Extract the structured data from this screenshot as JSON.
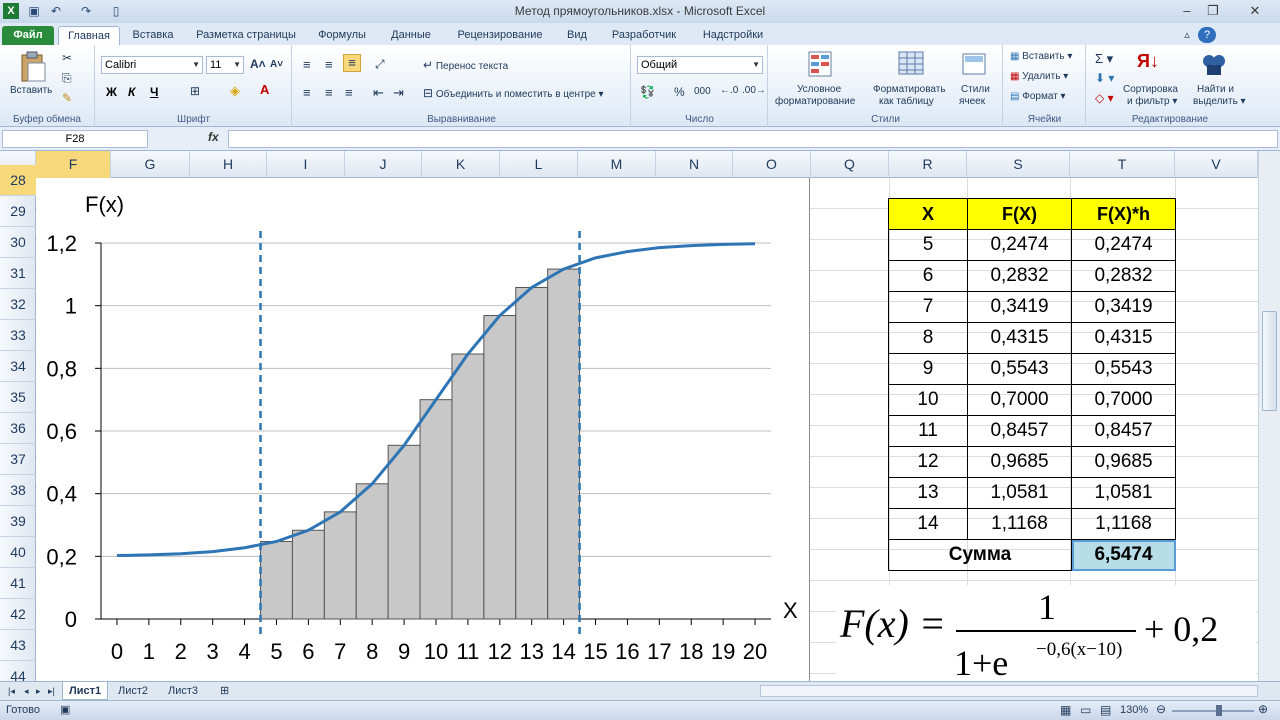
{
  "window": {
    "title": "Метод прямоугольников.xlsx  -  Microsoft Excel",
    "app_icon": "excel-logo-icon",
    "qat_icons": [
      "save-icon",
      "undo-icon",
      "redo-icon",
      "new-document-icon"
    ]
  },
  "tabs": [
    {
      "label": "Файл"
    },
    {
      "label": "Главная"
    },
    {
      "label": "Вставка"
    },
    {
      "label": "Разметка страницы"
    },
    {
      "label": "Формулы"
    },
    {
      "label": "Данные"
    },
    {
      "label": "Рецензирование"
    },
    {
      "label": "Вид"
    },
    {
      "label": "Разработчик"
    },
    {
      "label": "Надстройки"
    }
  ],
  "ribbon": {
    "clipboard": {
      "paste": "Вставить",
      "group": "Буфер обмена"
    },
    "font": {
      "name": "Calibri",
      "size": "11",
      "bold": "Ж",
      "italic": "К",
      "underline": "Ч",
      "group": "Шрифт"
    },
    "alignment": {
      "wrap": "Перенос текста",
      "merge": "Объединить и поместить в центре",
      "group": "Выравнивание"
    },
    "number": {
      "format": "Общий",
      "percent": "%",
      "thousands": "000",
      "group": "Число"
    },
    "styles": {
      "cond_line1": "Условное",
      "cond_line2": "форматирование",
      "table_line1": "Форматировать",
      "table_line2": "как таблицу",
      "cell_line1": "Стили",
      "cell_line2": "ячеек",
      "group": "Стили"
    },
    "cells": {
      "insert": "Вставить",
      "delete": "Удалить",
      "format": "Формат",
      "group": "Ячейки"
    },
    "editing": {
      "sort_line1": "Сортировка",
      "sort_line2": "и фильтр",
      "find_line1": "Найти и",
      "find_line2": "выделить",
      "group": "Редактирование"
    }
  },
  "formula_bar": {
    "name_box": "F28",
    "fx": "fx",
    "value": ""
  },
  "columns": [
    "F",
    "G",
    "H",
    "I",
    "J",
    "K",
    "L",
    "M",
    "N",
    "O",
    "Q",
    "R",
    "S",
    "T",
    "V"
  ],
  "rows": [
    "28",
    "29",
    "30",
    "31",
    "32",
    "33",
    "34",
    "35",
    "36",
    "37",
    "38",
    "39",
    "40",
    "41",
    "42",
    "43",
    "44"
  ],
  "selected_column": "F",
  "selected_row": "28",
  "table": {
    "headers": [
      "X",
      "F(X)",
      "F(X)*h"
    ],
    "rows": [
      [
        "5",
        "0,2474",
        "0,2474"
      ],
      [
        "6",
        "0,2832",
        "0,2832"
      ],
      [
        "7",
        "0,3419",
        "0,3419"
      ],
      [
        "8",
        "0,4315",
        "0,4315"
      ],
      [
        "9",
        "0,5543",
        "0,5543"
      ],
      [
        "10",
        "0,7000",
        "0,7000"
      ],
      [
        "11",
        "0,8457",
        "0,8457"
      ],
      [
        "12",
        "0,9685",
        "0,9685"
      ],
      [
        "13",
        "1,0581",
        "1,0581"
      ],
      [
        "14",
        "1,1168",
        "1,1168"
      ]
    ],
    "sum_label": "Сумма",
    "sum_value": "6,5474"
  },
  "chart_data": {
    "type": "bar",
    "xlabel": "X",
    "ylabel": "F(x)",
    "xlim": [
      -0.5,
      20.5
    ],
    "ylim": [
      0,
      1.2
    ],
    "x_ticks": [
      "0",
      "1",
      "2",
      "3",
      "4",
      "5",
      "6",
      "7",
      "8",
      "9",
      "10",
      "11",
      "12",
      "13",
      "14",
      "15",
      "16",
      "17",
      "18",
      "19",
      "20"
    ],
    "y_ticks": [
      "0",
      "0,2",
      "0,4",
      "0,6",
      "0,8",
      "1",
      "1,2"
    ],
    "grid": true,
    "series": [
      {
        "type": "bar",
        "x": [
          5,
          6,
          7,
          8,
          9,
          10,
          11,
          12,
          13,
          14
        ],
        "values": [
          0.2474,
          0.2832,
          0.3419,
          0.4315,
          0.5543,
          0.7,
          0.8457,
          0.9685,
          1.0581,
          1.1168
        ]
      },
      {
        "type": "line",
        "x": [
          0,
          1,
          2,
          3,
          4,
          5,
          6,
          7,
          8,
          9,
          10,
          11,
          12,
          13,
          14,
          15,
          16,
          17,
          18,
          19,
          20
        ],
        "values": [
          0.2025,
          0.2045,
          0.2082,
          0.2149,
          0.2274,
          0.2474,
          0.2832,
          0.3419,
          0.4315,
          0.5543,
          0.7,
          0.8457,
          0.9685,
          1.0581,
          1.1168,
          1.1526,
          1.1726,
          1.1851,
          1.1918,
          1.1955,
          1.1975
        ]
      }
    ],
    "vlines_x": [
      4.5,
      14.5
    ],
    "colors": {
      "bars": "#c8c8c8",
      "bar_edge": "#555555",
      "line": "#2e75b6",
      "vlines": "#2e75b6"
    }
  },
  "formula": {
    "lhs": "F(x) =",
    "numerator": "1",
    "denominator": "1+e",
    "exponent": "−0,6(x−10)",
    "plus": "+ 0,2"
  },
  "sheets": [
    "Лист1",
    "Лист2",
    "Лист3"
  ],
  "status": {
    "ready": "Готово",
    "zoom": "130%"
  }
}
